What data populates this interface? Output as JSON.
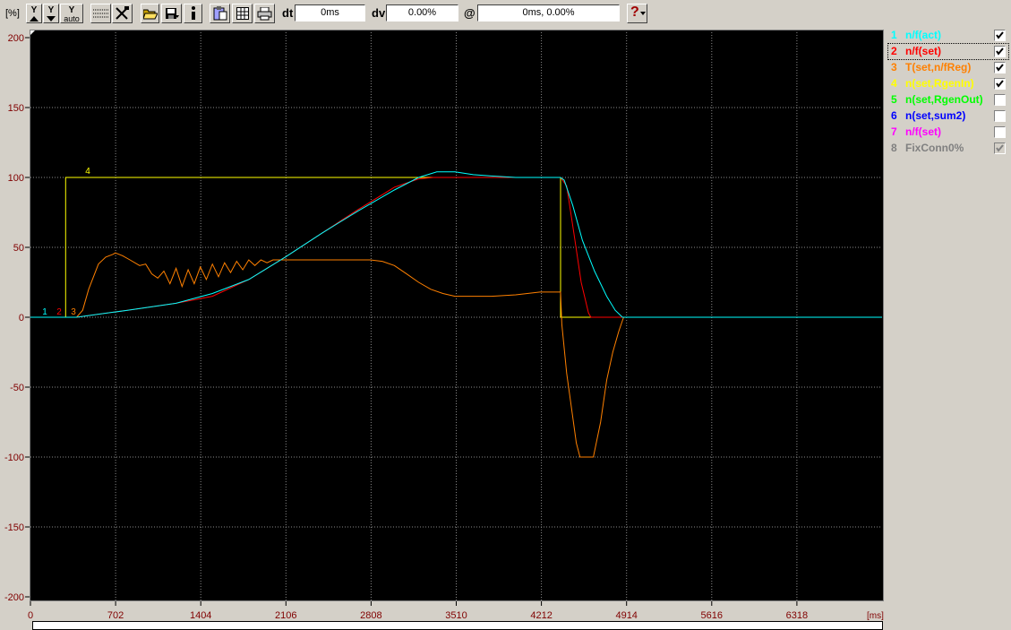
{
  "toolbar": {
    "y_unit": "[%]",
    "btn_y_up": "Y",
    "btn_y_down": "Y",
    "btn_y_auto_top": "Y",
    "btn_y_auto_bottom": "auto",
    "dt_label": "dt",
    "dt_value": "0ms",
    "dv_label": "dv",
    "dv_value": "0.00%",
    "at_label": "@",
    "at_value": "0ms, 0.00%",
    "help_label": "?"
  },
  "legend": {
    "items": [
      {
        "num": "1",
        "label": "n/f(act)",
        "color": "#00ffff",
        "checked": true,
        "disabled": false
      },
      {
        "num": "2",
        "label": "n/f(set)",
        "color": "#ff0000",
        "checked": true,
        "disabled": false,
        "selected": true
      },
      {
        "num": "3",
        "label": "T(set,n/fReg)",
        "color": "#ff8000",
        "checked": true,
        "disabled": false
      },
      {
        "num": "4",
        "label": "n(set,RgenIn)",
        "color": "#ffff00",
        "checked": true,
        "disabled": false
      },
      {
        "num": "5",
        "label": "n(set,RgenOut)",
        "color": "#00ff00",
        "checked": false,
        "disabled": false
      },
      {
        "num": "6",
        "label": "n(set,sum2)",
        "color": "#0000ff",
        "checked": false,
        "disabled": false
      },
      {
        "num": "7",
        "label": "n/f(set)",
        "color": "#ff00ff",
        "checked": false,
        "disabled": false
      },
      {
        "num": "8",
        "label": "FixConn0%",
        "color": "#808080",
        "checked": true,
        "disabled": true
      }
    ]
  },
  "chart_data": {
    "type": "line",
    "xlabel": "[ms]",
    "ylabel": "[%]",
    "xlim": [
      0,
      7020
    ],
    "ylim": [
      -200,
      200
    ],
    "x_ticks": [
      "0",
      "702",
      "1404",
      "2106",
      "2808",
      "3510",
      "4212",
      "4914",
      "5616",
      "6318"
    ],
    "y_ticks": [
      "200",
      "150",
      "100",
      "50",
      "0",
      "-50",
      "-100",
      "-150",
      "-200"
    ],
    "grid": true,
    "background": "#000000",
    "series": [
      {
        "name": "n/f(act)",
        "label": "1",
        "color": "#00ffff",
        "x": [
          0,
          380,
          800,
          1200,
          1500,
          1800,
          2100,
          2400,
          2700,
          3000,
          3200,
          3350,
          3500,
          3650,
          3800,
          4000,
          4200,
          4370,
          4400,
          4470,
          4550,
          4650,
          4750,
          4820,
          4880,
          4920,
          7020
        ],
        "y": [
          0,
          0,
          5,
          10,
          17,
          27,
          43,
          60,
          76,
          91,
          100,
          104,
          104,
          102,
          101,
          100,
          100,
          100,
          98,
          80,
          55,
          33,
          15,
          5,
          0,
          0,
          0
        ]
      },
      {
        "name": "n/f(set)",
        "label": "2",
        "color": "#ff0000",
        "x": [
          0,
          380,
          800,
          1200,
          1500,
          1800,
          2100,
          2400,
          2700,
          3000,
          3200,
          3320,
          3400,
          4370,
          4420,
          4480,
          4540,
          4600,
          4620,
          7020
        ],
        "y": [
          0,
          0,
          5,
          10,
          15,
          27,
          43,
          60,
          77,
          93,
          99,
          100,
          100,
          100,
          94,
          60,
          25,
          3,
          0,
          0
        ]
      },
      {
        "name": "T(set,n/fReg)",
        "label": "3",
        "color": "#ff8000",
        "x": [
          0,
          380,
          430,
          480,
          560,
          620,
          680,
          700,
          760,
          820,
          900,
          950,
          1000,
          1050,
          1100,
          1150,
          1200,
          1250,
          1300,
          1350,
          1400,
          1450,
          1500,
          1550,
          1600,
          1650,
          1700,
          1750,
          1800,
          1850,
          1900,
          1950,
          2000,
          2100,
          2200,
          2400,
          2600,
          2800,
          2900,
          3000,
          3100,
          3200,
          3300,
          3400,
          3500,
          3600,
          3800,
          4000,
          4200,
          4370,
          4380,
          4420,
          4500,
          4530,
          4600,
          4640,
          4700,
          4750,
          4800,
          4850,
          4890,
          7020
        ],
        "y": [
          0,
          0,
          5,
          20,
          38,
          43,
          45,
          46,
          44,
          41,
          37,
          38,
          31,
          28,
          33,
          24,
          35,
          22,
          34,
          24,
          36,
          27,
          38,
          29,
          39,
          32,
          40,
          34,
          41,
          37,
          41,
          39,
          41,
          41,
          41,
          41,
          41,
          41,
          40,
          37,
          31,
          25,
          20,
          17,
          15,
          15,
          15,
          16,
          18,
          18,
          -5,
          -40,
          -90,
          -100,
          -100,
          -100,
          -75,
          -45,
          -25,
          -10,
          0,
          0
        ]
      },
      {
        "name": "n(set,RgenIn)",
        "label": "4",
        "color": "#ffff00",
        "x": [
          0,
          290,
          290,
          4370,
          4370,
          7020
        ],
        "y": [
          0,
          0,
          100,
          100,
          0,
          0
        ]
      }
    ]
  }
}
